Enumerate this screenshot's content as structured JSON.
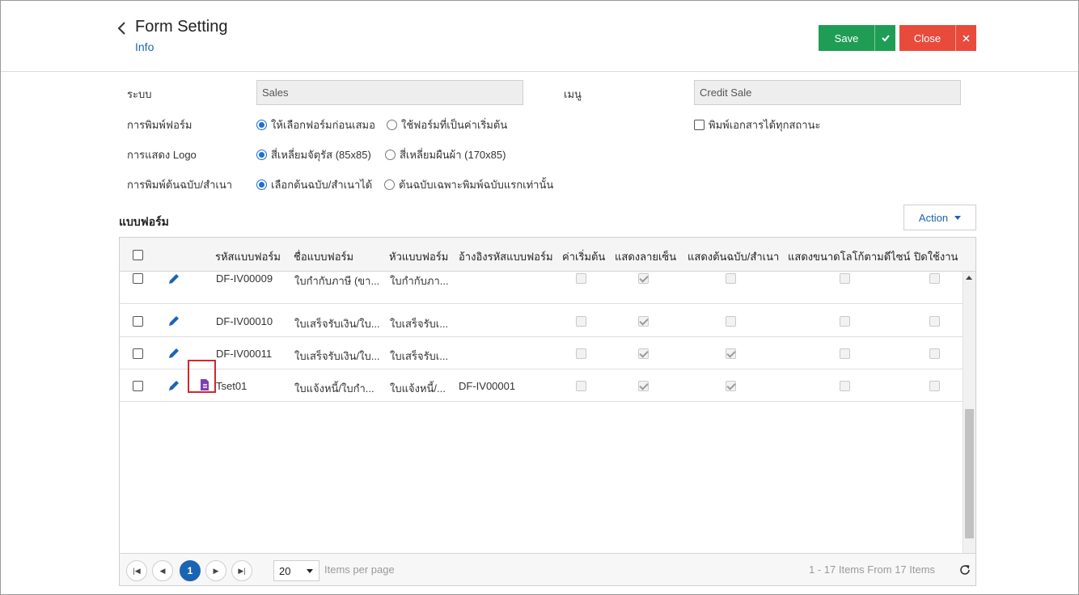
{
  "header": {
    "title": "Form Setting",
    "subtitle": "Info",
    "save_label": "Save",
    "close_label": "Close",
    "save_color": "#1f9d55",
    "close_color": "#e84b3c"
  },
  "form": {
    "system_label": "ระบบ",
    "system_value": "Sales",
    "menu_label": "เมนู",
    "menu_value": "Credit Sale",
    "print_form_label": "การพิมพ์ฟอร์ม",
    "print_form_opt1": "ให้เลือกฟอร์มก่อนเสมอ",
    "print_form_opt2": "ใช้ฟอร์มที่เป็นค่าเริ่มต้น",
    "print_form_selected": 1,
    "print_all_status": "พิมพ์เอกสารได้ทุกสถานะ",
    "logo_label": "การแสดง Logo",
    "logo_opt1": "สี่เหลี่ยมจัตุรัส (85x85)",
    "logo_opt2": "สี่เหลี่ยมผืนผ้า (170x85)",
    "logo_selected": 1,
    "copy_label": "การพิมพ์ต้นฉบับ/สำเนา",
    "copy_opt1": "เลือกต้นฉบับ/สำเนาได้",
    "copy_opt2": "ต้นฉบับเฉพาะพิมพ์ฉบับแรกเท่านั้น",
    "copy_selected": 1
  },
  "section_title": "แบบฟอร์ม",
  "action_label": "Action",
  "table": {
    "columns": [
      "รหัสแบบฟอร์ม",
      "ชื่อแบบฟอร์ม",
      "หัวแบบฟอร์ม",
      "อ้างอิงรหัสแบบฟอร์ม",
      "ค่าเริ่มต้น",
      "แสดงลายเซ็น",
      "แสดงต้นฉบับ/สำเนา",
      "แสดงขนาดโลโก้ตามดีไซน์",
      "ปิดใช้งาน"
    ],
    "rows": [
      {
        "code": "DF-IV00009",
        "name": "ใบกำกับภาษี (ขา...",
        "head": "ใบกำกับภา...",
        "ref": "",
        "default": false,
        "signature": true,
        "copy": false,
        "logo": false,
        "disabled": false,
        "doc_icon": false
      },
      {
        "code": "DF-IV00010",
        "name": "ใบเสร็จรับเงิน/ใบ...",
        "head": "ใบเสร็จรับเ...",
        "ref": "",
        "default": false,
        "signature": true,
        "copy": false,
        "logo": false,
        "disabled": false,
        "doc_icon": false
      },
      {
        "code": "DF-IV00011",
        "name": "ใบเสร็จรับเงิน/ใบ...",
        "head": "ใบเสร็จรับเ...",
        "ref": "",
        "default": false,
        "signature": true,
        "copy": true,
        "logo": false,
        "disabled": false,
        "doc_icon": false
      },
      {
        "code": "Tset01",
        "name": "ใบแจ้งหนี้/ใบกำ...",
        "head": "ใบแจ้งหนี้/...",
        "ref": "DF-IV00001",
        "default": false,
        "signature": true,
        "copy": true,
        "logo": false,
        "disabled": false,
        "doc_icon": true
      }
    ]
  },
  "pager": {
    "current_page": "1",
    "page_size": "20",
    "items_per_page": "Items per page",
    "summary": "1 - 17 Items From 17 Items"
  },
  "icons": {
    "back": "chevron-left-icon",
    "edit": "pencil-icon",
    "document": "document-icon",
    "refresh": "refresh-icon"
  },
  "colors": {
    "link": "#1a64b4",
    "doc_icon": "#7b3fb5",
    "highlight": "#d0282b"
  }
}
